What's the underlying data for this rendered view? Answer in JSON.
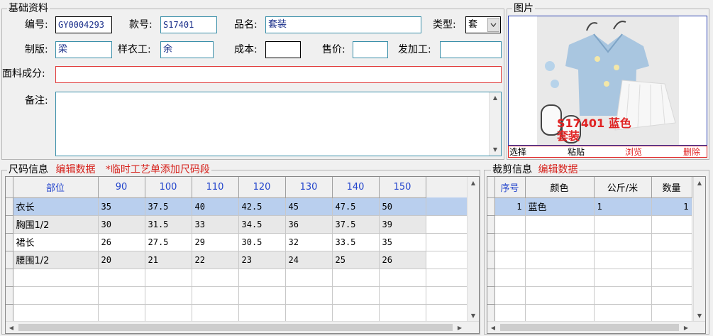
{
  "basic": {
    "legend": "基础资料",
    "code_label": "编号:",
    "code_value": "GY0004293",
    "style_label": "款号:",
    "style_value": "S17401",
    "name_label": "品名:",
    "name_value": "套装",
    "type_label": "类型:",
    "type_value": "套",
    "pattern_label": "制版:",
    "pattern_value": "梁",
    "sample_label": "样衣工:",
    "sample_value": "余",
    "cost_label": "成本:",
    "cost_value": "",
    "price_label": "售价:",
    "price_value": "",
    "processor_label": "发加工:",
    "processor_value": "",
    "fabric_label": "面料成分:",
    "fabric_value": "",
    "remark_label": "备注:",
    "remark_value": ""
  },
  "photo": {
    "legend": "图片",
    "caption_line1": "S17401  蓝色",
    "caption_line2": "套装",
    "buttons": [
      "选择",
      "粘贴",
      "浏览",
      "删除"
    ],
    "colors": {
      "shirt": "#a9c6e0",
      "skirt": "#f4f4f4",
      "bg": "#e9e9e9",
      "caption": "#e02222"
    }
  },
  "size": {
    "legend": "尺码信息",
    "edit_label": "编辑数据",
    "note": "*临时工艺单添加尺码段",
    "headers": [
      "部位",
      "90",
      "100",
      "110",
      "120",
      "130",
      "140",
      "150"
    ],
    "rows": [
      [
        "衣长",
        "35",
        "37.5",
        "40",
        "42.5",
        "45",
        "47.5",
        "50"
      ],
      [
        "胸围1/2",
        "30",
        "31.5",
        "33",
        "34.5",
        "36",
        "37.5",
        "39"
      ],
      [
        "裙长",
        "26",
        "27.5",
        "29",
        "30.5",
        "32",
        "33.5",
        "35"
      ],
      [
        "腰围1/2",
        "20",
        "21",
        "22",
        "23",
        "24",
        "25",
        "26"
      ]
    ]
  },
  "cut": {
    "legend": "裁剪信息",
    "edit_label": "编辑数据",
    "headers": [
      "序号",
      "颜色",
      "公斤/米",
      "数量"
    ],
    "rows": [
      [
        "1",
        "蓝色",
        "1",
        "1"
      ]
    ]
  }
}
